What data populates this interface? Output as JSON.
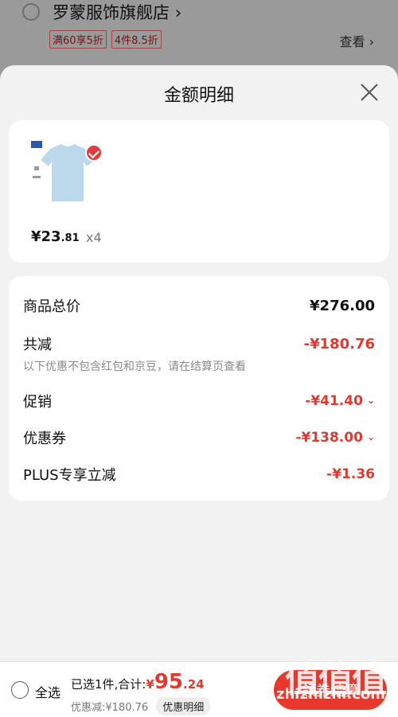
{
  "background": {
    "shop_name": "罗蒙服饰旗舰店",
    "shop_chevron": "›",
    "promo_tags": [
      "满60享5折",
      "4件8.5折"
    ],
    "view_label": "查看 ›"
  },
  "sheet": {
    "title": "金额明细",
    "product": {
      "price_symbol": "¥",
      "price_int": "23",
      "price_dec": ".81",
      "quantity": "x4",
      "selected": true
    },
    "summary": {
      "total_label": "商品总价",
      "total_value": "¥276.00",
      "reduce_label": "共减",
      "reduce_value": "-¥180.76",
      "reduce_note": "以下优惠不包含红包和京豆，请在结算页查看",
      "items": [
        {
          "label": "促销",
          "value": "-¥41.40",
          "expandable": true
        },
        {
          "label": "优惠券",
          "value": "-¥138.00",
          "expandable": true
        },
        {
          "label": "PLUS专享立减",
          "value": "-¥1.36",
          "expandable": false
        }
      ]
    }
  },
  "bottom_bar": {
    "select_all_label": "全选",
    "selected_text": "已选1件,合计:",
    "total_symbol": "¥",
    "total_int": "95",
    "total_dec": ".24",
    "discount_text": "优惠减:¥180.76",
    "detail_button": "优惠明细",
    "checkout_label": "领券结算"
  },
  "watermark": {
    "logo": "值值值",
    "site": "zhizhizhi.com"
  },
  "colors": {
    "accent_red": "#e03a2e",
    "sheet_bg": "#f2f2f2"
  }
}
